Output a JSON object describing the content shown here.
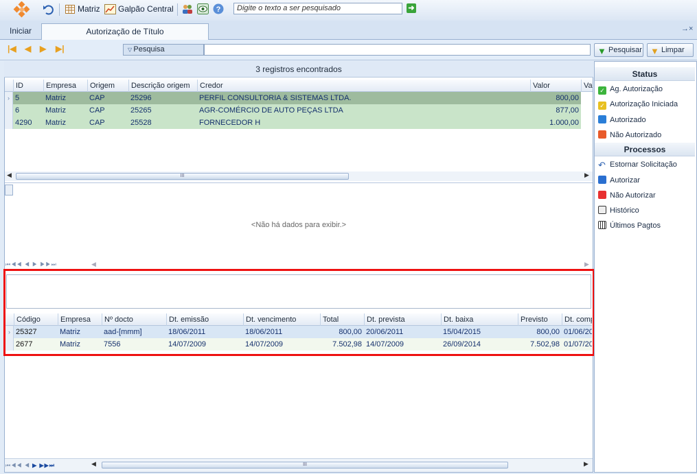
{
  "toolbar": {
    "matriz": "Matriz",
    "galpao": "Galpão Central",
    "search_placeholder": "Digite o texto a ser pesquisado"
  },
  "tabs": {
    "iniciar": "Iniciar",
    "active": "Autorização de Título",
    "pin": "→×"
  },
  "nav": {
    "pesquisa": "Pesquisa",
    "btn_pesquisar": "Pesquisar",
    "btn_limpar": "Limpar"
  },
  "grid1": {
    "count": "3 registros encontrados",
    "headers": [
      "ID",
      "Empresa",
      "Origem",
      "Descrição origem",
      "Credor",
      "Valor",
      "Var"
    ],
    "rows": [
      [
        "5",
        "Matriz",
        "CAP",
        "25296",
        "PERFIL CONSULTORIA & SISTEMAS LTDA.",
        "800,00"
      ],
      [
        "6",
        "Matriz",
        "CAP",
        "25265",
        "AGR-COMÉRCIO DE AUTO PEÇAS LTDA",
        "877,00"
      ],
      [
        "4290",
        "Matriz",
        "CAP",
        "25528",
        "FORNECEDOR H",
        "1.000,00"
      ]
    ]
  },
  "grid2": {
    "nodata": "<Não há dados para exibir.>"
  },
  "grid3": {
    "headers": [
      "Código",
      "Empresa",
      "Nº docto",
      "Dt. emissão",
      "Dt. vencimento",
      "Total",
      "Dt. prevista",
      "Dt. baixa",
      "Previsto",
      "Dt. comp"
    ],
    "rows": [
      [
        "25327",
        "Matriz",
        "aad-[mmm]",
        "18/06/2011",
        "18/06/2011",
        "800,00",
        "20/06/2011",
        "15/04/2015",
        "800,00",
        "01/06/20"
      ],
      [
        "2677",
        "Matriz",
        "7556",
        "14/07/2009",
        "14/07/2009",
        "7.502,98",
        "14/07/2009",
        "26/09/2014",
        "7.502,98",
        "01/07/20"
      ]
    ]
  },
  "side": {
    "status_title": "Status",
    "status": [
      "Ag. Autorização",
      "Autorização Iniciada",
      "Autorizado",
      "Não Autorizado"
    ],
    "processos_title": "Processos",
    "processos": [
      "Estornar Solicitação",
      "Autorizar",
      "Não Autorizar",
      "Histórico",
      "Últimos Pagtos"
    ]
  },
  "colors": {
    "ag": "#3cb43c",
    "iniciada": "#e8c020",
    "autorizado": "#2a7ed8",
    "nao": "#e85a2a",
    "autorizar": "#2a6fd0",
    "nao_autorizar": "#e83030"
  }
}
